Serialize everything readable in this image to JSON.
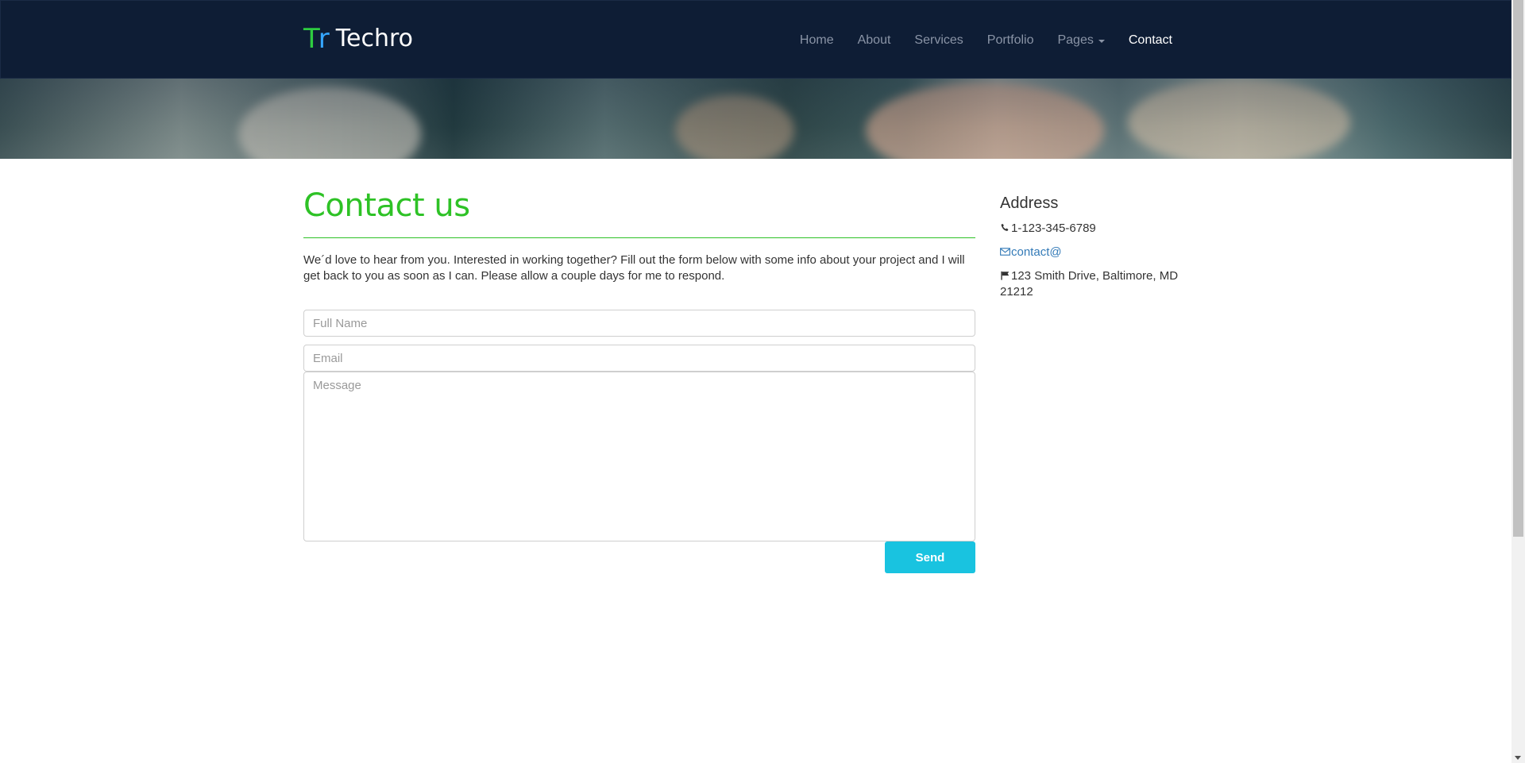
{
  "navbar": {
    "brand_mark_t": "T",
    "brand_mark_r": "r",
    "brand_name": "Techro",
    "items": [
      {
        "label": "Home"
      },
      {
        "label": "About"
      },
      {
        "label": "Services"
      },
      {
        "label": "Portfolio"
      },
      {
        "label": "Pages"
      },
      {
        "label": "Contact"
      }
    ],
    "active": "Contact"
  },
  "contact": {
    "title": "Contact us",
    "intro": "We´d love to hear from you. Interested in working together? Fill out the form below with some info about your project and I will get back to you as soon as I can. Please allow a couple days for me to respond.",
    "fullname_placeholder": "Full Name",
    "email_placeholder": "Email",
    "message_placeholder": "Message",
    "send_label": "Send"
  },
  "sidebar": {
    "title": "Address",
    "phone": "1-123-345-6789",
    "email": "contact@",
    "address": "123 Smith Drive, Baltimore, MD 21212"
  },
  "colors": {
    "navbar_bg": "#0e1d35",
    "accent_green": "#2ec226",
    "button_cyan": "#19c3e0",
    "link_blue": "#337ab7"
  }
}
